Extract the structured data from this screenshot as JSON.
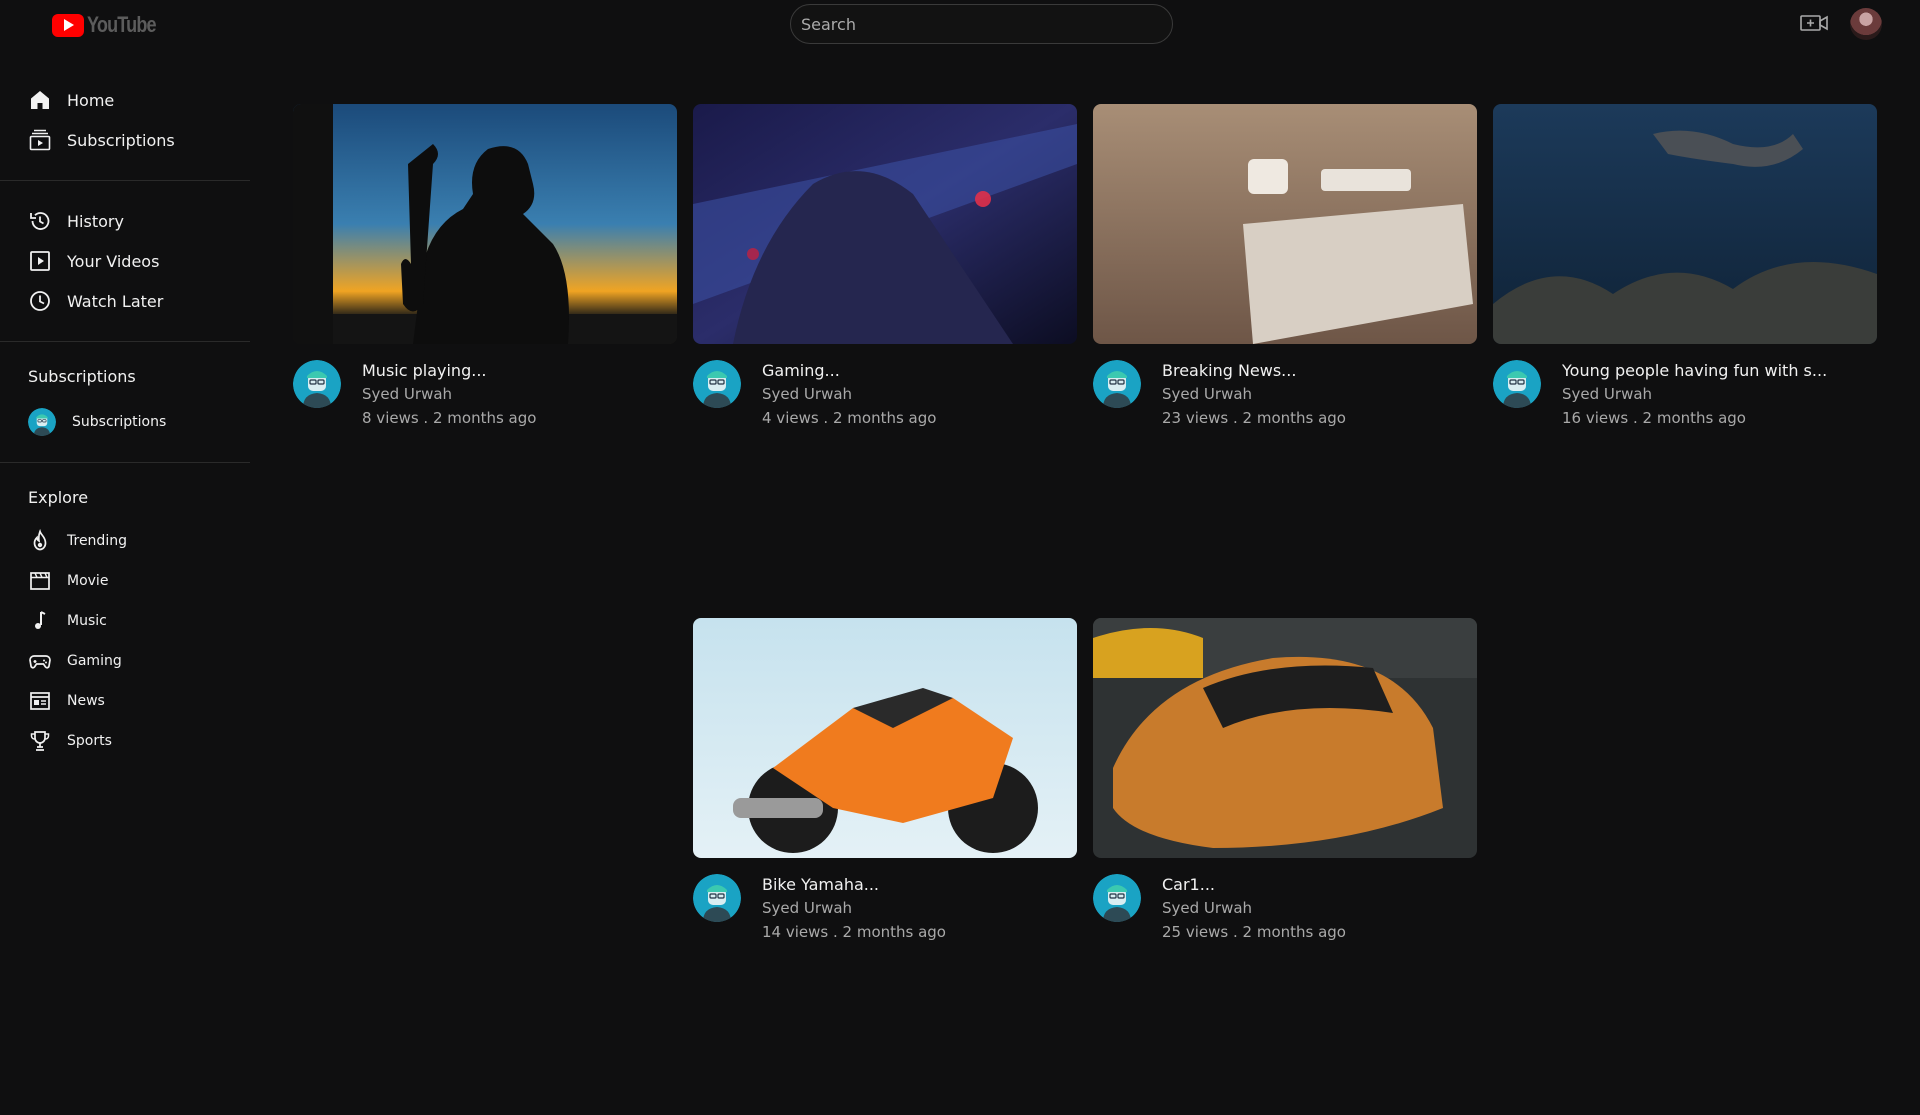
{
  "header": {
    "logo_text": "YouTube",
    "search_placeholder": "Search",
    "create_icon": "video-camera-plus-icon",
    "avatar": "user-avatar"
  },
  "sidebar": {
    "main": [
      {
        "label": "Home",
        "icon": "home-icon"
      },
      {
        "label": "Subscriptions",
        "icon": "subscriptions-icon"
      }
    ],
    "library": [
      {
        "label": "History",
        "icon": "history-icon"
      },
      {
        "label": "Your Videos",
        "icon": "your-videos-icon"
      },
      {
        "label": "Watch Later",
        "icon": "clock-icon"
      }
    ],
    "subscriptions_heading": "Subscriptions",
    "subscriptions": [
      {
        "label": "Subscriptions",
        "icon": "channel-avatar"
      }
    ],
    "explore_heading": "Explore",
    "explore": [
      {
        "label": "Trending",
        "icon": "fire-icon"
      },
      {
        "label": "Movie",
        "icon": "clapperboard-icon"
      },
      {
        "label": "Music",
        "icon": "music-note-icon"
      },
      {
        "label": "Gaming",
        "icon": "gamepad-icon"
      },
      {
        "label": "News",
        "icon": "newspaper-icon"
      },
      {
        "label": "Sports",
        "icon": "trophy-icon"
      }
    ]
  },
  "videos": [
    {
      "title": "Music playing...",
      "channel": "Syed Urwah",
      "stats": "8 views . 2 months ago"
    },
    {
      "title": "Gaming...",
      "channel": "Syed Urwah",
      "stats": "4 views . 2 months ago"
    },
    {
      "title": "Breaking News...",
      "channel": "Syed Urwah",
      "stats": "23 views . 2 months ago"
    },
    {
      "title": "Young people having fun with s...",
      "channel": "Syed Urwah",
      "stats": "16 views . 2 months ago"
    },
    {
      "title": "Bike Yamaha...",
      "channel": "Syed Urwah",
      "stats": "14 views . 2 months ago"
    },
    {
      "title": "Car1...",
      "channel": "Syed Urwah",
      "stats": "25 views . 2 months ago"
    }
  ]
}
